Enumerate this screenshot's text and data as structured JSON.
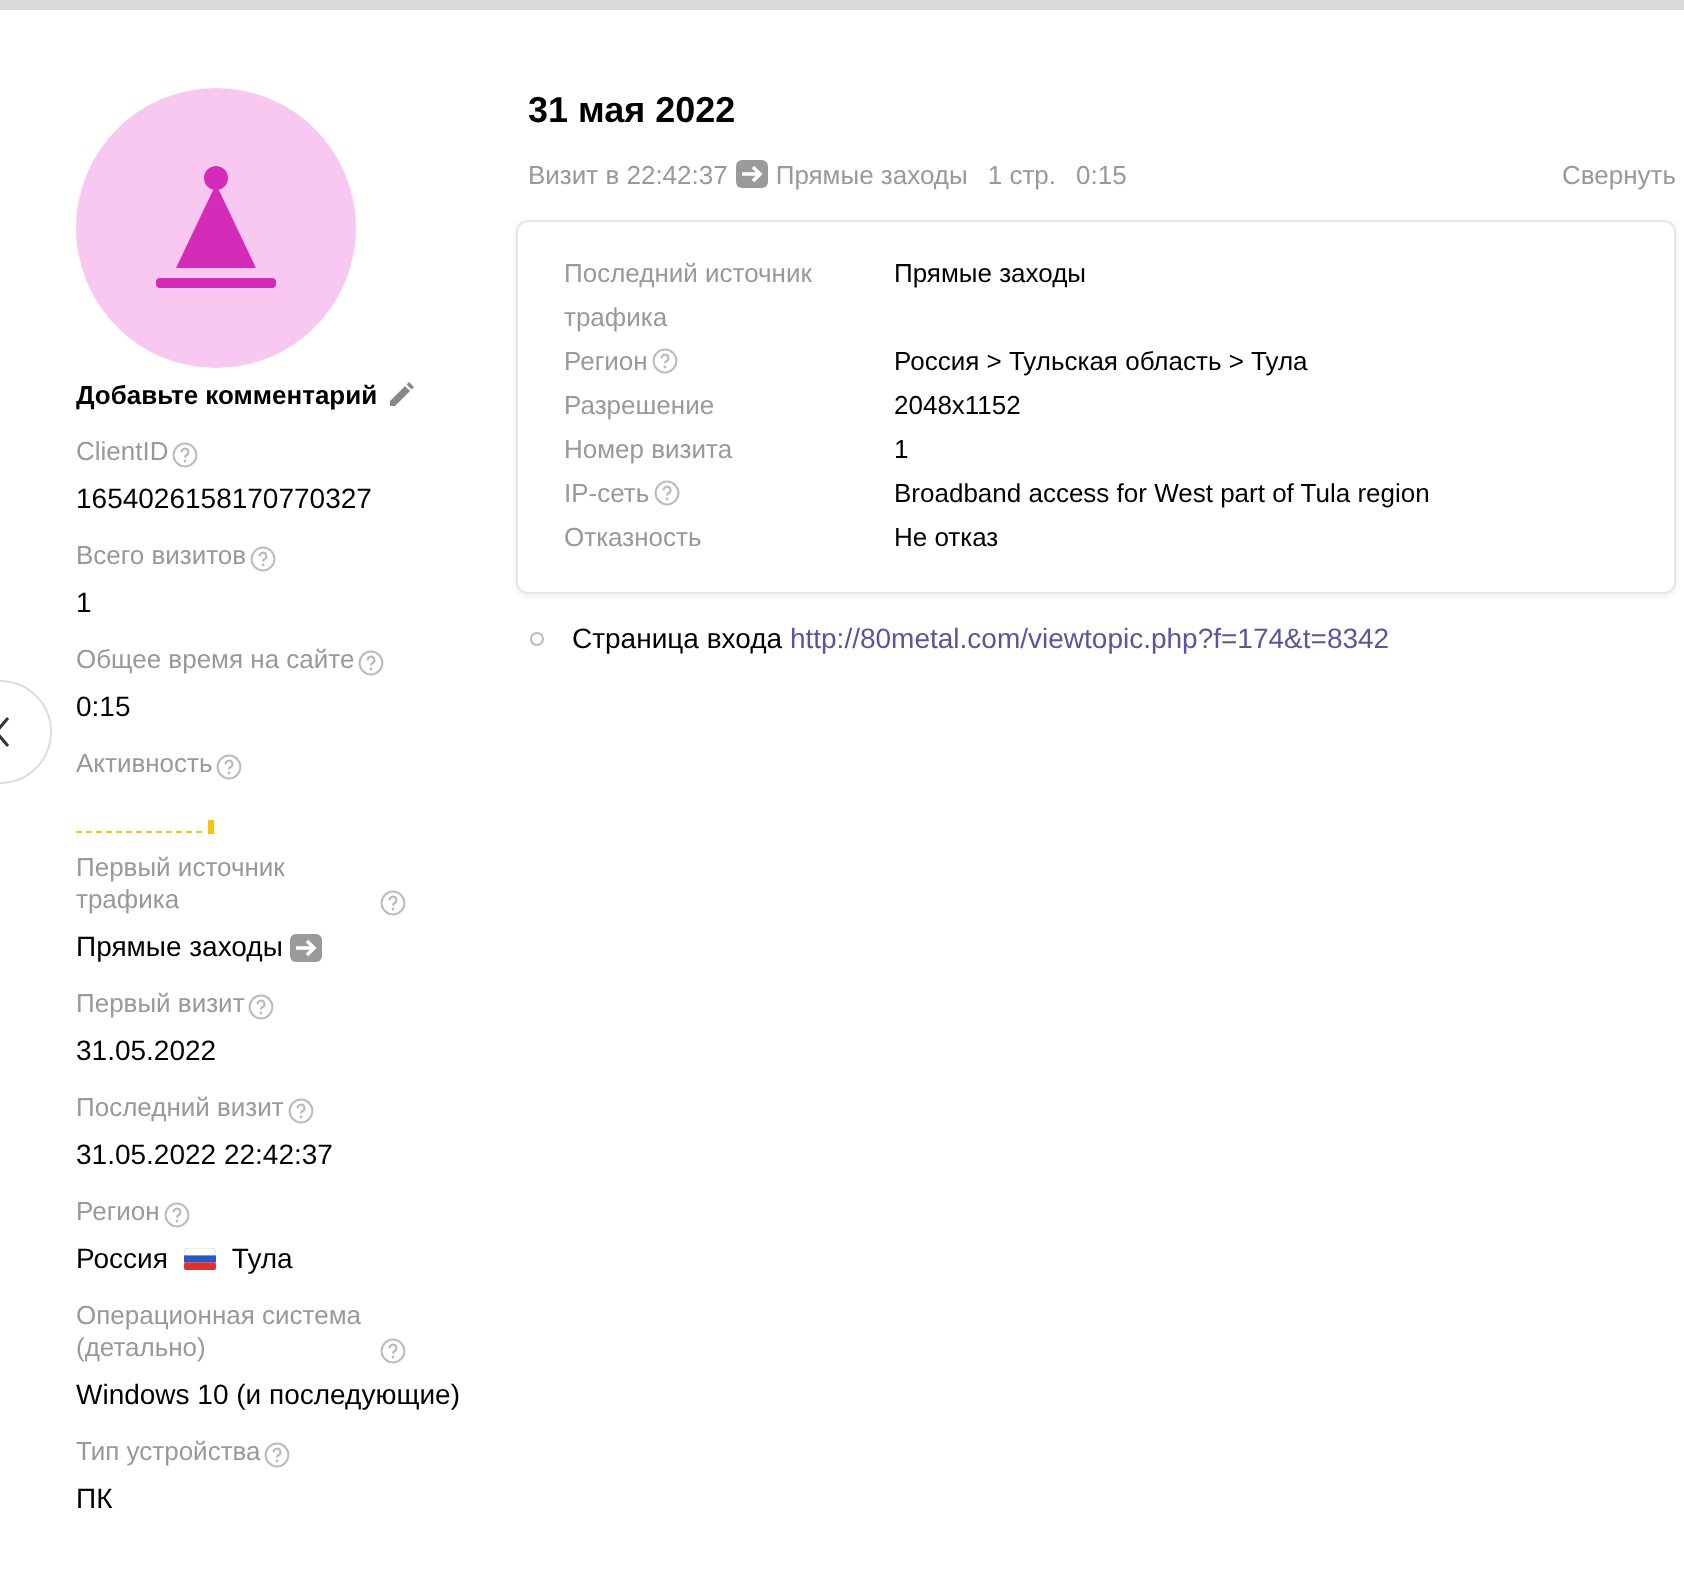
{
  "profile": {
    "comment": "Добавьте комментарий",
    "fields": [
      {
        "kind": "text",
        "label": "ClientID",
        "help": true,
        "value": "1654026158170770327"
      },
      {
        "kind": "text",
        "label": "Всего визитов",
        "help": true,
        "value": "1"
      },
      {
        "kind": "text",
        "label": "Общее время на сайте",
        "help": true,
        "value": "0:15"
      },
      {
        "kind": "activity",
        "label": "Активность",
        "help": true
      },
      {
        "kind": "source",
        "label": "Первый источник трафика",
        "help": true,
        "value": "Прямые заходы"
      },
      {
        "kind": "text",
        "label": "Первый визит",
        "help": true,
        "value": "31.05.2022"
      },
      {
        "kind": "text",
        "label": "Последний визит",
        "help": true,
        "value": "31.05.2022 22:42:37"
      },
      {
        "kind": "region",
        "label": "Регион",
        "help": true,
        "country": "Россия",
        "city": "Тула"
      },
      {
        "kind": "text",
        "label": "Операционная система (детально)",
        "help": true,
        "value": "Windows 10 (и последующие)"
      },
      {
        "kind": "text",
        "label": "Тип устройства",
        "help": true,
        "value": "ПК"
      }
    ]
  },
  "visit": {
    "date": "31 мая 2022",
    "time": "Визит в 22:42:37",
    "source": "Прямые заходы",
    "pages": "1 стр.",
    "duration": "0:15",
    "collapse": "Свернуть",
    "details": [
      {
        "label": "Последний источник трафика",
        "help": false,
        "value": "Прямые заходы"
      },
      {
        "label": "Регион",
        "help": true,
        "value": "Россия > Тульская область > Тула"
      },
      {
        "label": "Разрешение",
        "help": false,
        "value": "2048x1152"
      },
      {
        "label": "Номер визита",
        "help": false,
        "value": "1"
      },
      {
        "label": "IP-сеть",
        "help": true,
        "value": "Broadband access for West part of Tula region"
      },
      {
        "label": "Отказность",
        "help": false,
        "value": "Не отказ"
      }
    ],
    "entry_label": "Страница входа",
    "entry_url": "http://80metal.com/viewtopic.php?f=174&t=8342"
  }
}
